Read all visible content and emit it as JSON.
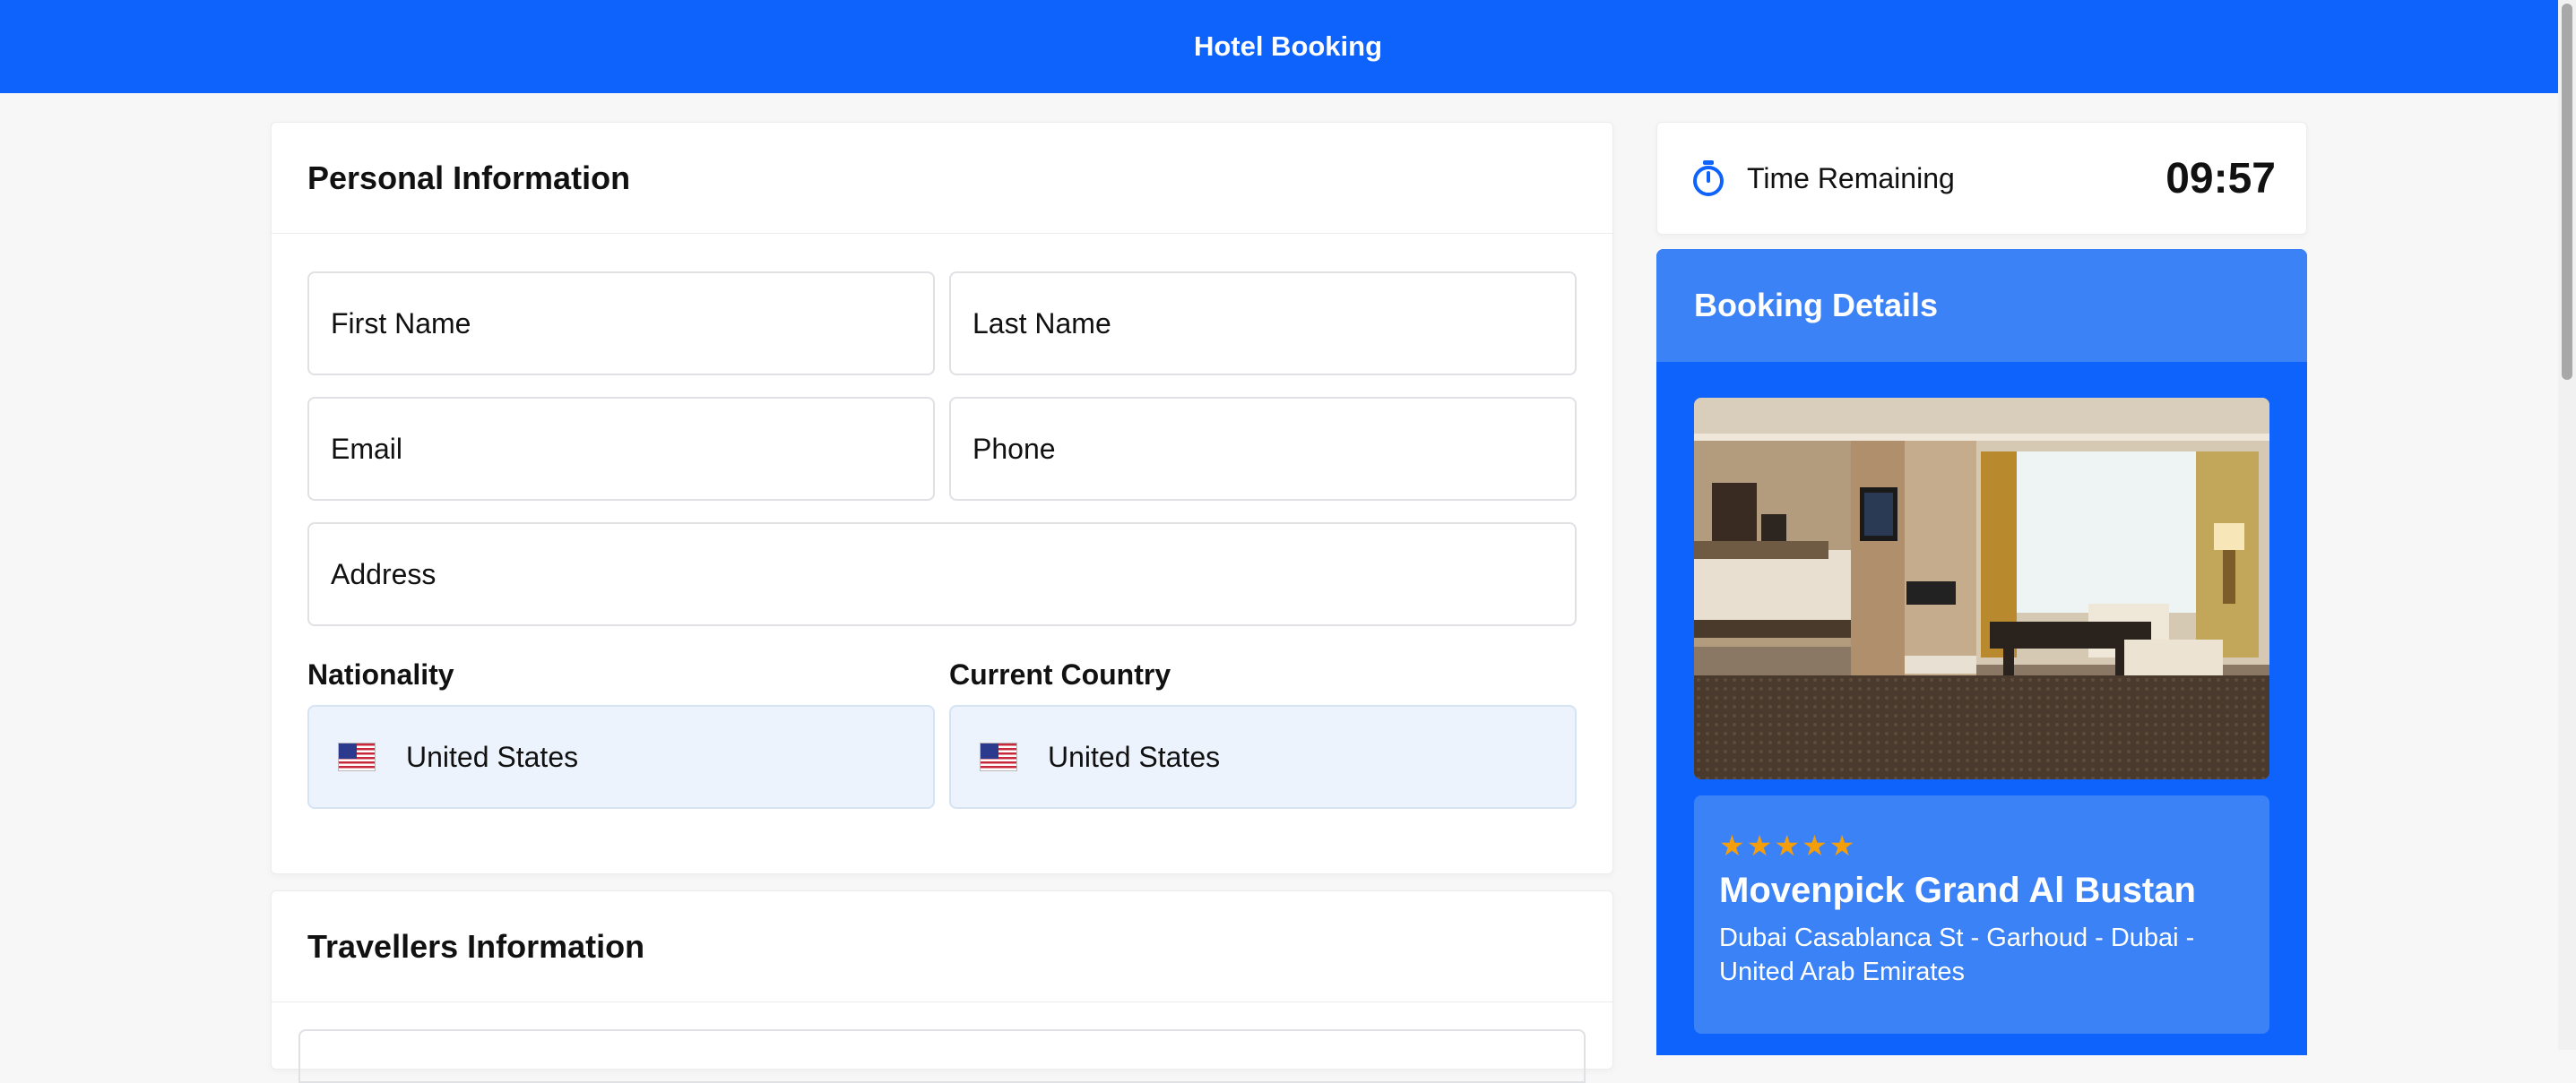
{
  "header": {
    "title": "Hotel Booking"
  },
  "personal": {
    "title": "Personal Information",
    "fields": {
      "first_name_placeholder": "First Name",
      "last_name_placeholder": "Last Name",
      "email_placeholder": "Email",
      "phone_placeholder": "Phone",
      "address_placeholder": "Address"
    },
    "nationality": {
      "label": "Nationality",
      "value": "United States",
      "flag": "us-flag"
    },
    "current_country": {
      "label": "Current Country",
      "value": "United States",
      "flag": "us-flag"
    }
  },
  "travellers": {
    "title": "Travellers Information"
  },
  "timer": {
    "label": "Time Remaining",
    "value": "09:57",
    "icon": "stopwatch-icon"
  },
  "booking": {
    "title": "Booking Details",
    "hotel": {
      "stars": "★★★★★",
      "star_count": 5,
      "name": "Movenpick Grand Al Bustan",
      "address": "Dubai Casablanca St - Garhoud - Dubai - United Arab Emirates"
    }
  },
  "colors": {
    "primary": "#0d63fb",
    "accent": "#3b82f6",
    "star": "#f59e0b"
  }
}
